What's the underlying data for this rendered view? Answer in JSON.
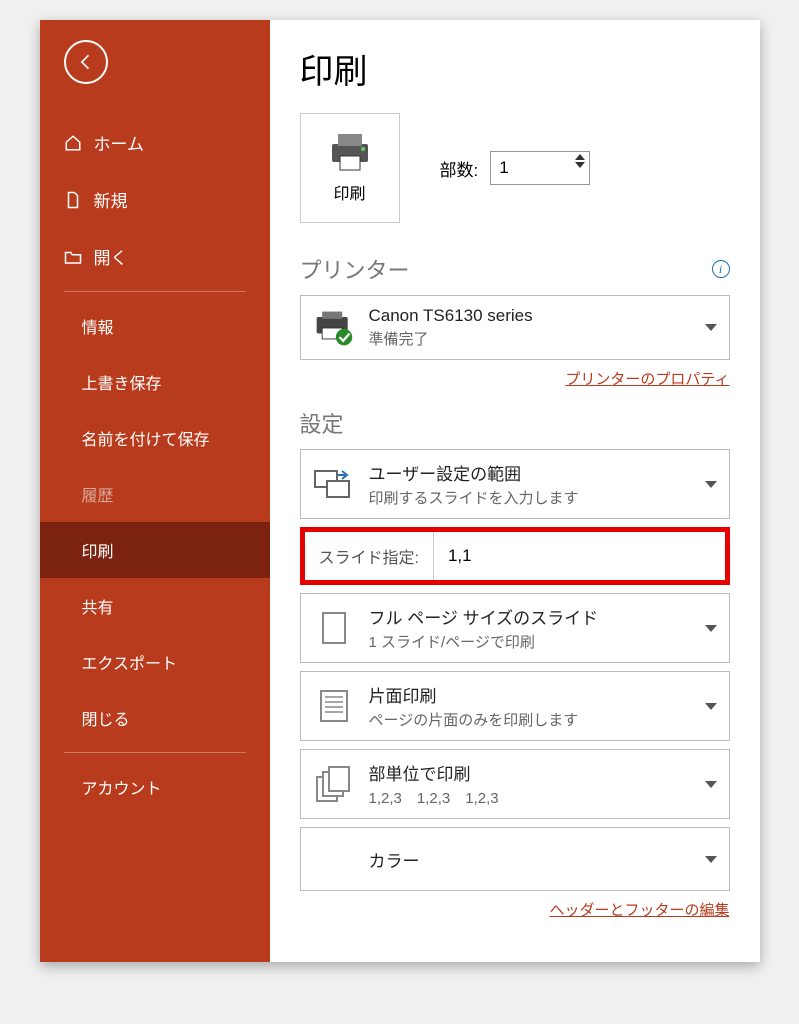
{
  "sidebar": {
    "items": [
      {
        "icon": "home",
        "label": "ホーム"
      },
      {
        "icon": "file",
        "label": "新規"
      },
      {
        "icon": "folder",
        "label": "開く"
      }
    ],
    "subitems": [
      {
        "label": "情報"
      },
      {
        "label": "上書き保存"
      },
      {
        "label": "名前を付けて保存"
      },
      {
        "label": "履歴",
        "dim": true
      },
      {
        "label": "印刷",
        "active": true
      },
      {
        "label": "共有"
      },
      {
        "label": "エクスポート"
      },
      {
        "label": "閉じる"
      }
    ],
    "bottom": [
      {
        "label": "アカウント"
      }
    ]
  },
  "page": {
    "title": "印刷",
    "print_btn_label": "印刷",
    "copies_label": "部数:",
    "copies_value": "1"
  },
  "printer": {
    "section_title": "プリンター",
    "name": "Canon TS6130 series",
    "status": "準備完了",
    "properties_link": "プリンターのプロパティ"
  },
  "settings": {
    "section_title": "設定",
    "range": {
      "title": "ユーザー設定の範囲",
      "sub": "印刷するスライドを入力します"
    },
    "slide_spec": {
      "label": "スライド指定:",
      "value": "1,1"
    },
    "layout": {
      "title": "フル ページ サイズのスライド",
      "sub": "1 スライド/ページで印刷"
    },
    "sides": {
      "title": "片面印刷",
      "sub": "ページの片面のみを印刷します"
    },
    "collate": {
      "title": "部単位で印刷",
      "sub": "1,2,3　1,2,3　1,2,3"
    },
    "color": {
      "title": "カラー"
    },
    "header_footer_link": "ヘッダーとフッターの編集"
  }
}
